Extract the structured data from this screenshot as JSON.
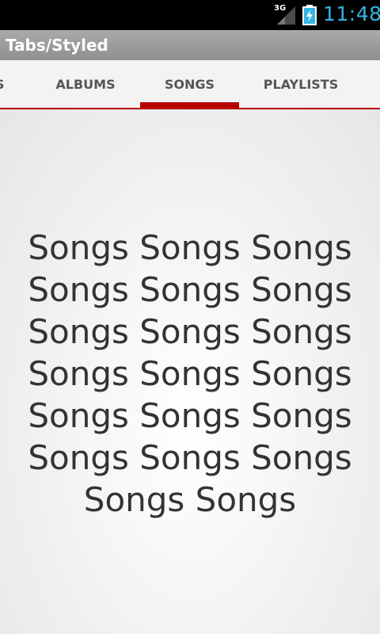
{
  "status_bar": {
    "network": "3G",
    "time": "11:48",
    "signal_icon": "signal-strength-icon",
    "battery_icon": "battery-charging-icon"
  },
  "action_bar": {
    "title": "Tabs/Styled"
  },
  "tabs": [
    {
      "label": "S",
      "selected": false
    },
    {
      "label": "ALBUMS",
      "selected": false
    },
    {
      "label": "SONGS",
      "selected": true
    },
    {
      "label": "PLAYLISTS",
      "selected": false
    }
  ],
  "content": {
    "text": "Songs Songs Songs Songs Songs Songs Songs Songs Songs Songs Songs Songs Songs Songs Songs Songs Songs Songs Songs Songs"
  },
  "colors": {
    "accent": "#b60000",
    "status_text": "#33b5e5",
    "action_bar": "#9e9e9e",
    "tab_text": "#555555",
    "content_text": "#333333"
  }
}
